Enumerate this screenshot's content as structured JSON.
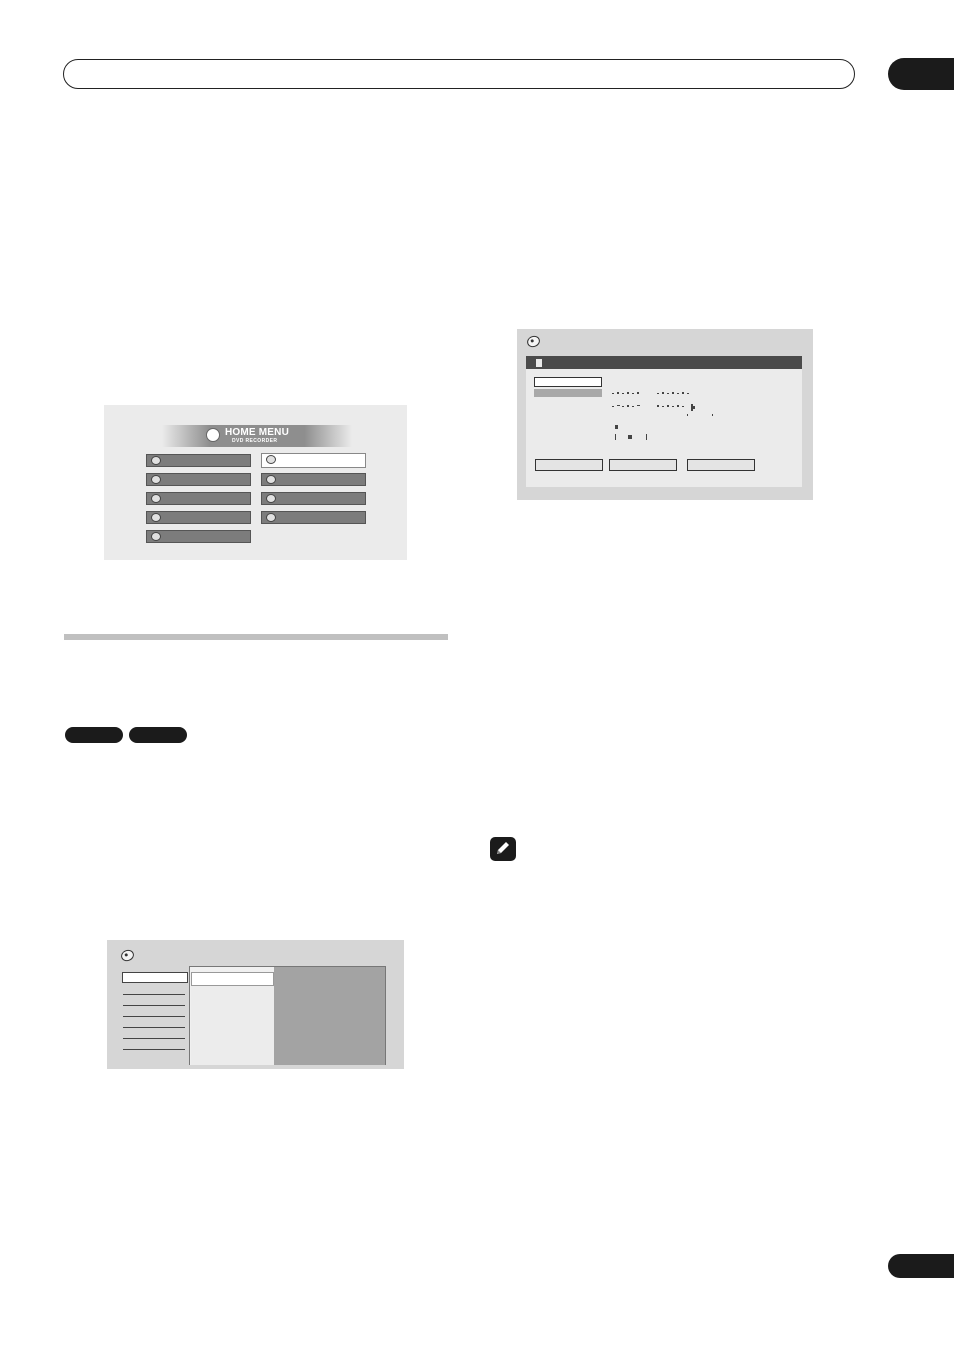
{
  "home_menu": {
    "title": "HOME MENU",
    "subtitle": "DVD RECORDER",
    "items": [
      {
        "id": "item-1",
        "icon": "clock-icon"
      },
      {
        "id": "item-2",
        "icon": "disc-dvd-icon"
      },
      {
        "id": "item-3",
        "icon": "gear-disc-icon"
      },
      {
        "id": "item-4",
        "icon": "book-icon"
      },
      {
        "id": "item-5",
        "icon": "arrow-disc-icon"
      },
      {
        "id": "item-6",
        "icon": "disc-icon",
        "selected": true
      },
      {
        "id": "item-7",
        "icon": "disc-gear-icon"
      },
      {
        "id": "item-8",
        "icon": "copy-icon"
      },
      {
        "id": "item-9",
        "icon": "disc-star-icon"
      }
    ]
  },
  "colors": {
    "dark": "#1b1b1b",
    "screen_bg": "#d6d6d6",
    "button_gray": "#7c7c7c",
    "panel_gray": "#a3a3a3",
    "rule_gray": "#c0c0c0"
  }
}
